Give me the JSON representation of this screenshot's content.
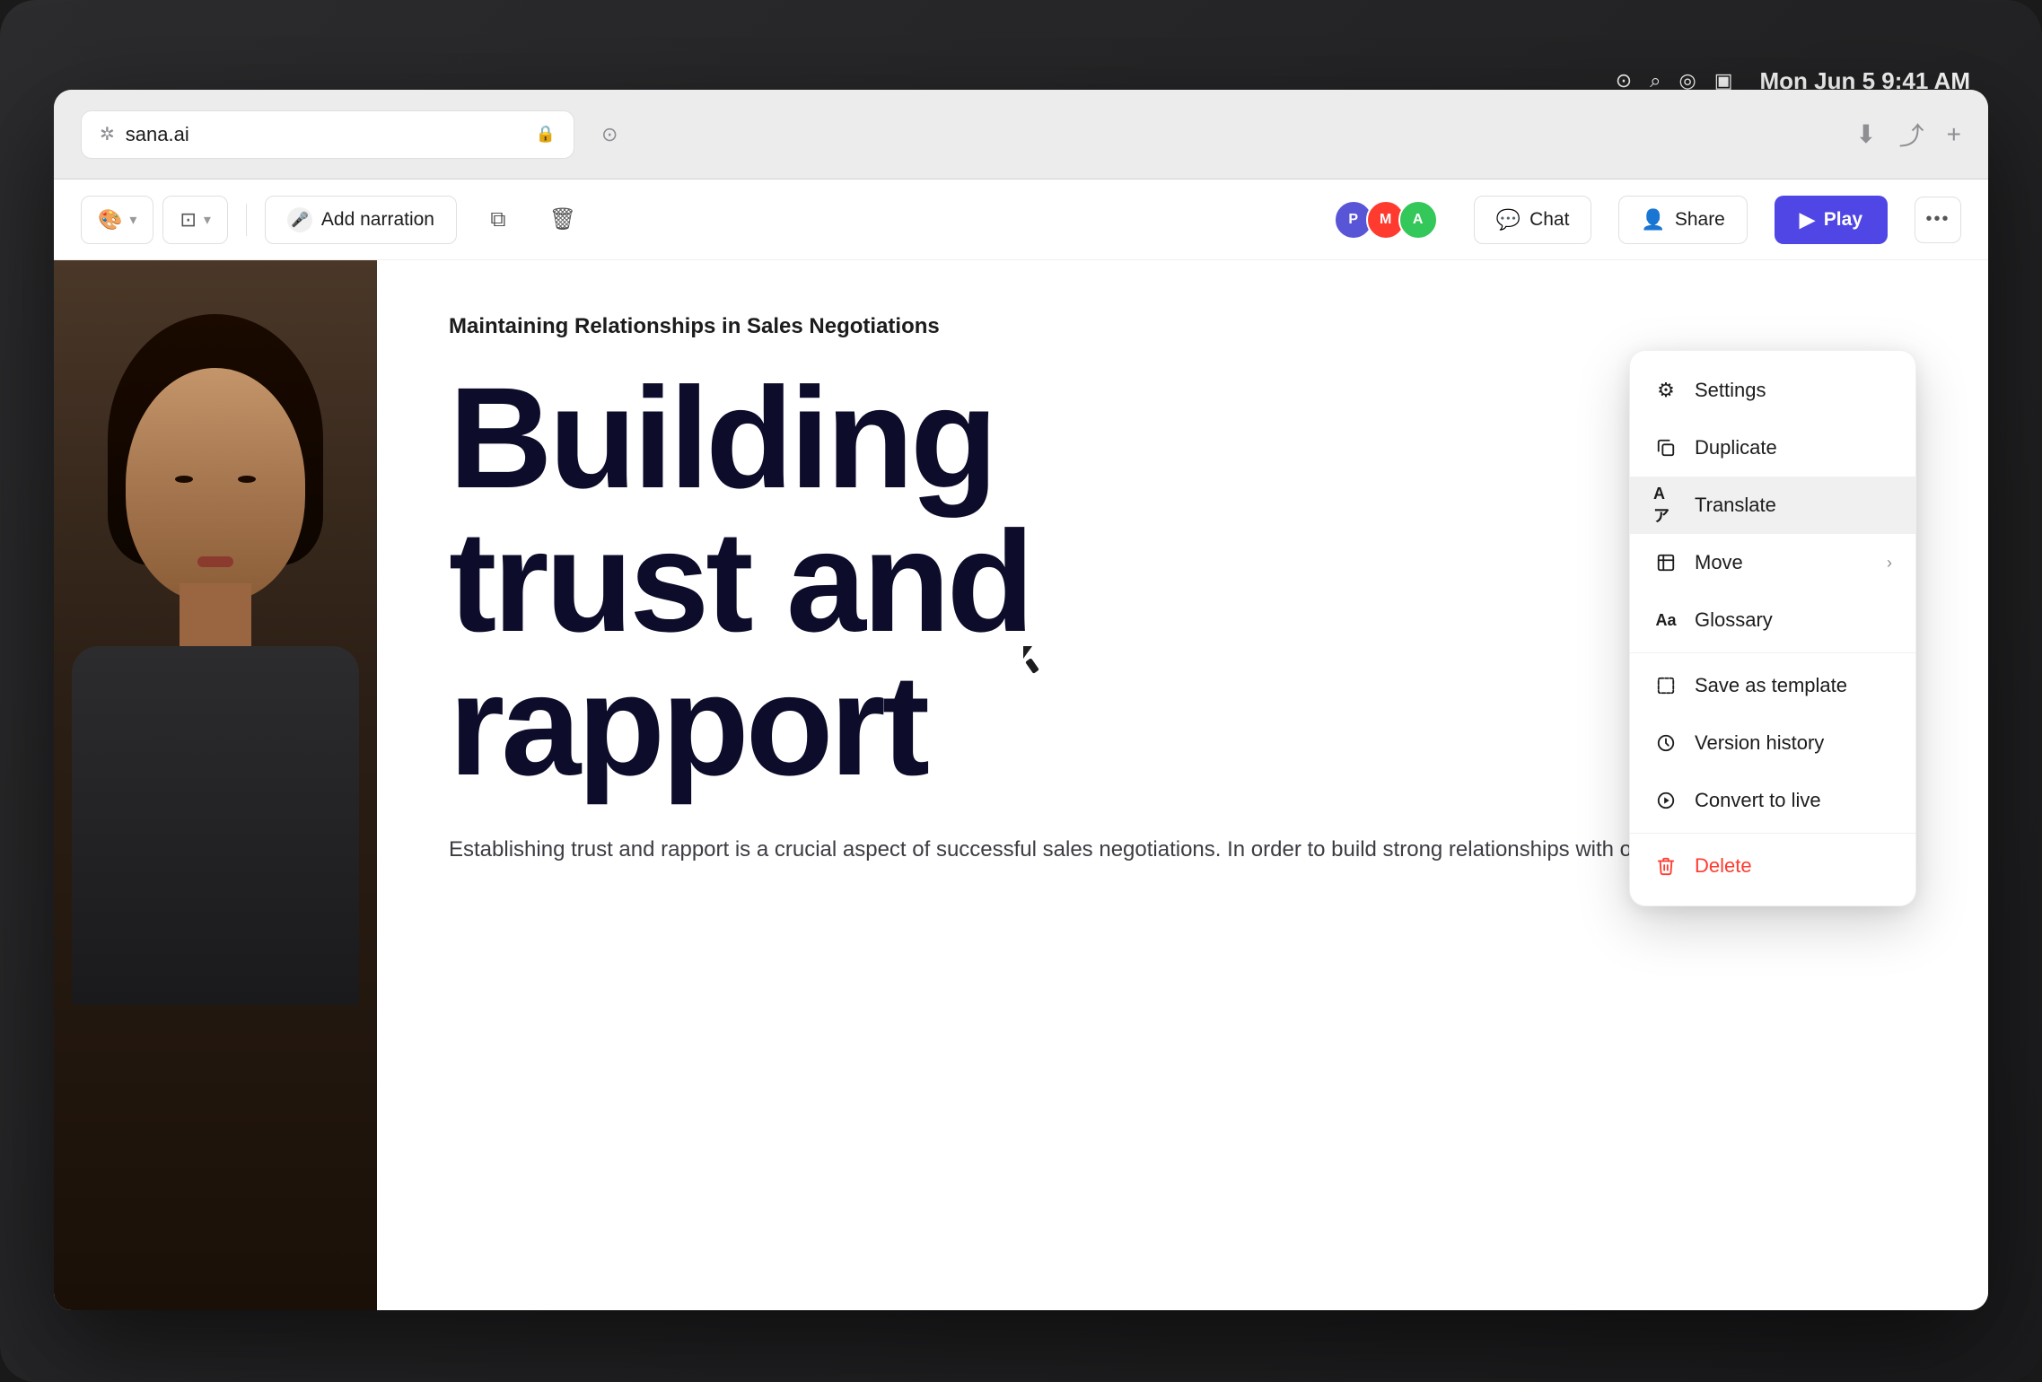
{
  "device": {
    "status_bar": {
      "time": "Mon Jun 5  9:41 AM"
    }
  },
  "browser": {
    "address": "sana.ai",
    "address_icon": "🌐",
    "lock_icon": "🔒"
  },
  "toolbar": {
    "theme_label": "🎨",
    "layout_label": "⊞",
    "add_narration_label": "Add narration",
    "copy_icon": "⧉",
    "delete_icon": "🗑",
    "chat_label": "Chat",
    "share_label": "Share",
    "play_label": "Play",
    "more_icon": "•••",
    "avatars": [
      {
        "initial": "P",
        "color": "#5856d6"
      },
      {
        "initial": "M",
        "color": "#ff3b30"
      },
      {
        "initial": "A",
        "color": "#34c759"
      }
    ]
  },
  "content": {
    "subtitle": "Maintaining Relationships in Sales Negotiations",
    "title_line1": "Building",
    "title_line2": "trust and",
    "title_line3": "rapport",
    "body_text": "Establishing trust and rapport is a crucial aspect of successful sales negotiations. In order to build strong relationships with our clients, it is"
  },
  "dropdown": {
    "items": [
      {
        "id": "settings",
        "label": "Settings",
        "icon": "⚙️",
        "has_chevron": false
      },
      {
        "id": "duplicate",
        "label": "Duplicate",
        "icon": "⧉",
        "has_chevron": false
      },
      {
        "id": "translate",
        "label": "Translate",
        "icon": "Aア",
        "has_chevron": false
      },
      {
        "id": "move",
        "label": "Move",
        "icon": "⊡",
        "has_chevron": true
      },
      {
        "id": "glossary",
        "label": "Glossary",
        "icon": "Aa",
        "has_chevron": false
      },
      {
        "id": "save-template",
        "label": "Save as template",
        "icon": "⊞",
        "has_chevron": false
      },
      {
        "id": "version-history",
        "label": "Version history",
        "icon": "🕐",
        "has_chevron": false
      },
      {
        "id": "convert-live",
        "label": "Convert to live",
        "icon": "▷",
        "has_chevron": false
      },
      {
        "id": "delete",
        "label": "Delete",
        "icon": "🗑",
        "has_chevron": false
      }
    ]
  }
}
